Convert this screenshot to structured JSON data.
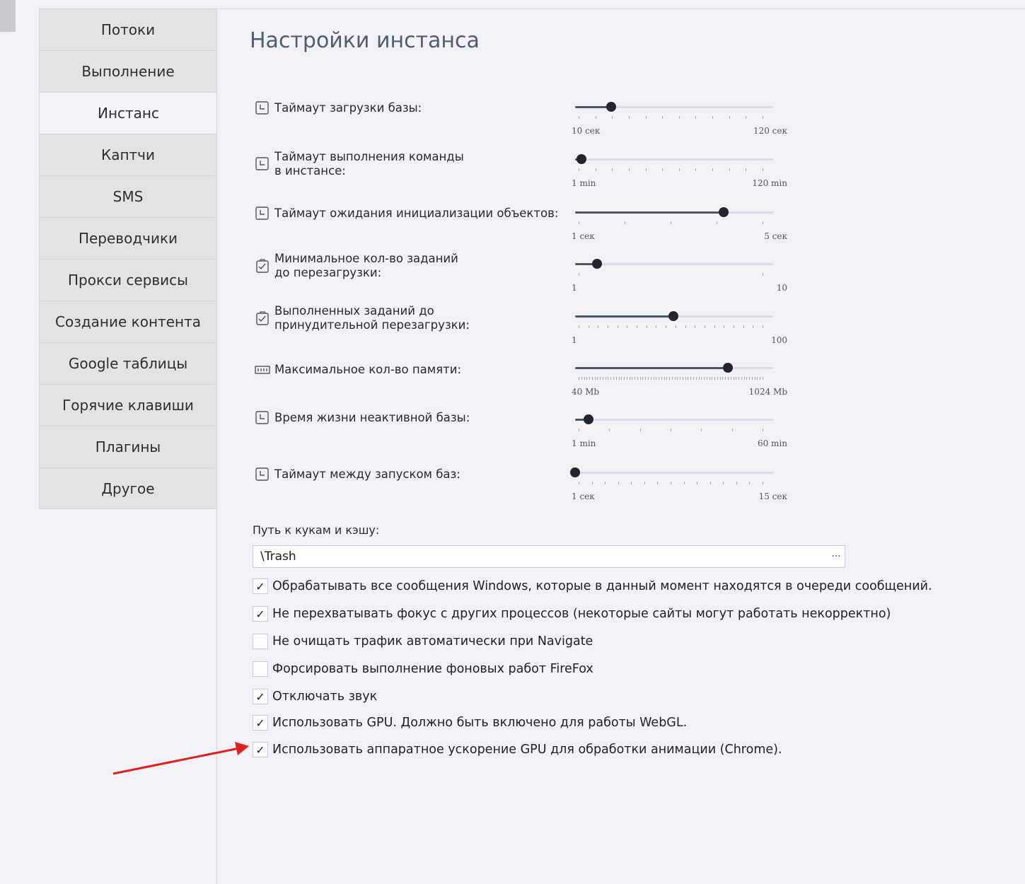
{
  "sidebar": {
    "items": [
      {
        "label": "Потоки",
        "active": false
      },
      {
        "label": "Выполнение",
        "active": false
      },
      {
        "label": "Инстанс",
        "active": true
      },
      {
        "label": "Каптчи",
        "active": false
      },
      {
        "label": "SMS",
        "active": false
      },
      {
        "label": "Переводчики",
        "active": false
      },
      {
        "label": "Прокси сервисы",
        "active": false
      },
      {
        "label": "Создание контента",
        "active": false
      },
      {
        "label": "Google таблицы",
        "active": false
      },
      {
        "label": "Горячие клавиши",
        "active": false
      },
      {
        "label": "Плагины",
        "active": false
      },
      {
        "label": "Другое",
        "active": false
      }
    ]
  },
  "main": {
    "title": "Настройки инстанса",
    "sliders": [
      {
        "label": "Таймаут загрузки базы:",
        "icon": "clock-icon",
        "min_label": "10 сек",
        "max_label": "120 сек",
        "min": 10,
        "max": 120,
        "value": 30,
        "ticks": 12
      },
      {
        "label": "Таймаут выполнения команды\nв инстансе:",
        "icon": "clock-icon",
        "min_label": "1 min",
        "max_label": "120 min",
        "min": 1,
        "max": 120,
        "value": 5,
        "ticks": 12
      },
      {
        "label": "Таймаут ожидания инициализации объектов:",
        "icon": "clock-icon",
        "min_label": "1 сек",
        "max_label": "5 сек",
        "min": 1,
        "max": 5,
        "value": 4,
        "ticks": 5
      },
      {
        "label": "Минимальное кол-во заданий\nдо перезагрузки:",
        "icon": "task-icon",
        "min_label": "1",
        "max_label": "10",
        "min": 1,
        "max": 10,
        "value": 2,
        "ticks": 2
      },
      {
        "label": "Выполненных заданий до\nпринудительной перезагрузки:",
        "icon": "task-icon",
        "min_label": "1",
        "max_label": "100",
        "min": 1,
        "max": 100,
        "value": 50,
        "ticks": 20
      },
      {
        "label": "Максимальное кол-во памяти:",
        "icon": "memory-icon",
        "min_label": "40 Mb",
        "max_label": "1024 Mb",
        "min": 40,
        "max": 1024,
        "value": 800,
        "ticks": 70
      },
      {
        "label": "Время жизни неактивной базы:",
        "icon": "clock-icon",
        "min_label": "1 min",
        "max_label": "60 min",
        "min": 1,
        "max": 60,
        "value": 5,
        "ticks": 7
      },
      {
        "label": "Таймаут между запуском баз:",
        "icon": "clock-icon",
        "min_label": "1 сек",
        "max_label": "15 сек",
        "min": 1,
        "max": 15,
        "value": 1,
        "ticks": 15
      }
    ],
    "path": {
      "label": "Путь к кукам и кэшу:",
      "value": "\\Trash",
      "browse_label": "···"
    },
    "checkboxes": [
      {
        "label": "Обрабатывать все сообщения Windows, которые в данный момент находятся в очереди сообщений.",
        "checked": true
      },
      {
        "label": "Не перехватывать фокус с других процессов (некоторые сайты могут работать некорректно)",
        "checked": true
      },
      {
        "label": "Не очищать трафик автоматически при Navigate",
        "checked": false
      },
      {
        "label": "Форсировать выполнение фоновых работ FireFox",
        "checked": false
      },
      {
        "label": "Отключать звук",
        "checked": true
      },
      {
        "label": "Использовать GPU. Должно быть включено для работы WebGL.",
        "checked": true
      },
      {
        "label": "Использовать аппаратное ускорение GPU для обработки анимации (Chrome).",
        "checked": true
      }
    ],
    "check_glyph": "✓"
  },
  "annotation": {
    "arrow_color": "#e02020"
  }
}
